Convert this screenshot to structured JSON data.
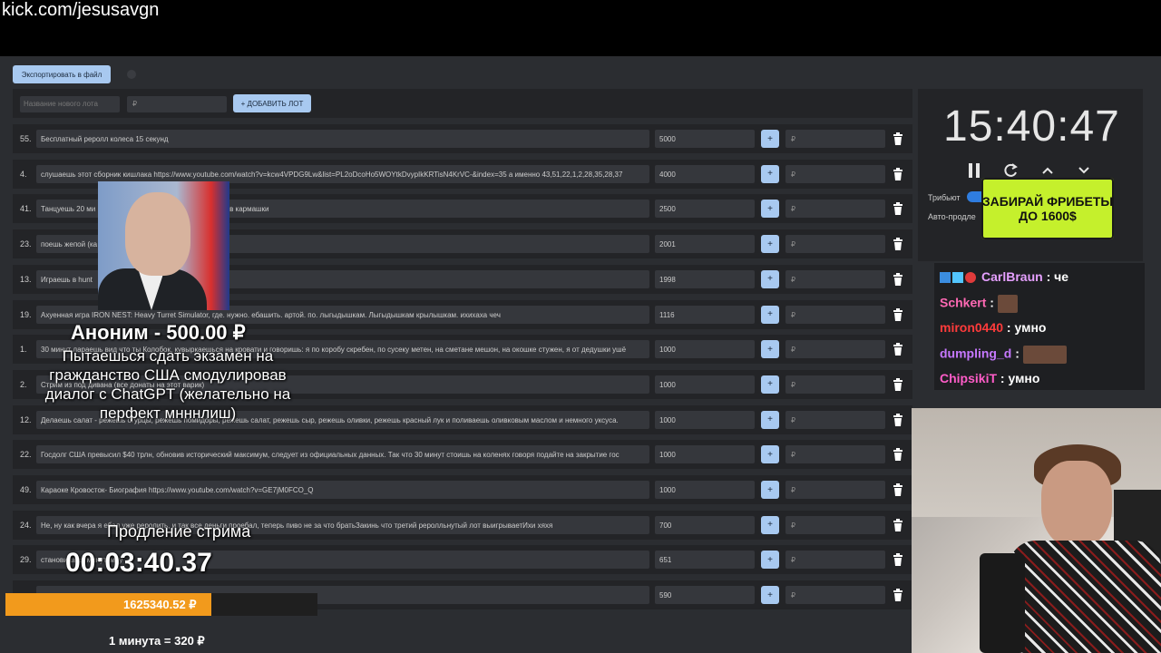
{
  "stream_url": "kick.com/jesusavgn",
  "toolbar": {
    "export_label": "Экспортировать в файл"
  },
  "add_lot": {
    "name_placeholder": "Название нового лота",
    "price_placeholder": "₽",
    "add_label": "+ ДОБАВИТЬ ЛОТ"
  },
  "lot_price_placeholder": "₽",
  "lots": [
    {
      "num": "55.",
      "name": "Бесплатный реролл колеса 15 секунд",
      "amount": "5000"
    },
    {
      "num": "4.",
      "name": "слушаешь этот сборник кишлака https://www.youtube.com/watch?v=kcw4VPDG9Lw&list=PL2oDcoHo5WOYtkDvypIkKRTisN4KrVC-&index=35 а именно 43,51,22,1,2,28,35,28,37",
      "amount": "4000"
    },
    {
      "num": "41.",
      "name": "Танцуешь 20 ми                                              RIK Ладошки крылышки / какашки мне в кармашки",
      "amount": "2500"
    },
    {
      "num": "23.",
      "name": "поешь жепой (ка                                              очелли",
      "amount": "2001"
    },
    {
      "num": "13.",
      "name": "Играешь в hunt",
      "amount": "1998"
    },
    {
      "num": "19.",
      "name": "Ахуенная игра IRON NEST: Heavy Turret Simulator, где. нужно. ебашить. артой. по. лыгыдышкам. Лыгыдышкам крылышкам. ихихаха чеч",
      "amount": "1116"
    },
    {
      "num": "1.",
      "name": "30 минут лараешь вид что ты Колобок, кувыркаешься на кровати и говоришь: я по коробу скребен, по сусеку метен, на сметане мешон, на окошке стужен, я от дедушки ушё",
      "amount": "1000"
    },
    {
      "num": "2.",
      "name": "Стрим из под дивана (все донаты на этот варик)",
      "amount": "1000"
    },
    {
      "num": "12.",
      "name": "Делаешь салат - режешь огурцы, режешь помидоры, режешь салат, режешь сыр, режешь оливки, режешь красный лук и поливаешь оливковым маслом и немного уксуса.",
      "amount": "1000"
    },
    {
      "num": "22.",
      "name": "Госдолг США превысил $40 трлн, обновив исторический максимум, следует из официальных данных. Так что 30 минут стоишь на коленях говоря подайте на закрытие гос",
      "amount": "1000"
    },
    {
      "num": "49.",
      "name": "Караоке Кровосток- Биография https://www.youtube.com/watch?v=GE7jM0FCO_Q",
      "amount": "1000"
    },
    {
      "num": "24.",
      "name": "Не, ну как вчера я ебал уже реролить, и так все деньги проебал, теперь пиво не за что братьЗакинь что третий реролльнутый лот выигрываетИхи хяхя",
      "amount": "700"
    },
    {
      "num": "29.",
      "name": "становишься                                                     минут. мяу",
      "amount": "651"
    },
    {
      "num": "",
      "name": "",
      "amount": "590"
    }
  ],
  "timer": {
    "clock": "15:40:47",
    "tribute_label": "Трибьют",
    "auto_label": "Авто-продле"
  },
  "promo": {
    "text": "ЗАБИРАЙ ФРИБЕТЫ ДО 1600$"
  },
  "chat": [
    {
      "user": "CarlBraun",
      "color": "#e6a0ff",
      "message": "че",
      "emote": false
    },
    {
      "user": "Schkert",
      "color": "#ff69b4",
      "message": "",
      "emote": true
    },
    {
      "user": "miron0440",
      "color": "#ff3b3b",
      "message": "умно",
      "emote": false
    },
    {
      "user": "dumpling_d",
      "color": "#c678ff",
      "message": "",
      "emote": true
    },
    {
      "user": "ChipsikiT",
      "color": "#ff5cc8",
      "message": "умно",
      "emote": false
    }
  ],
  "donation": {
    "donor": "Аноним - 500.00 ₽",
    "message": "Пытаешься сдать экзамен на гражданство США смодулировав диалог с ChatGPT (желательно на перфект мнннлиш)"
  },
  "extension": {
    "label": "Продление стрима",
    "timer": "00:03:40.37"
  },
  "progress": {
    "value_label": "1625340.52 ₽",
    "fill_fraction": 0.66,
    "accent": "#f29a1c"
  },
  "rate": "1 минута = 320 ₽"
}
